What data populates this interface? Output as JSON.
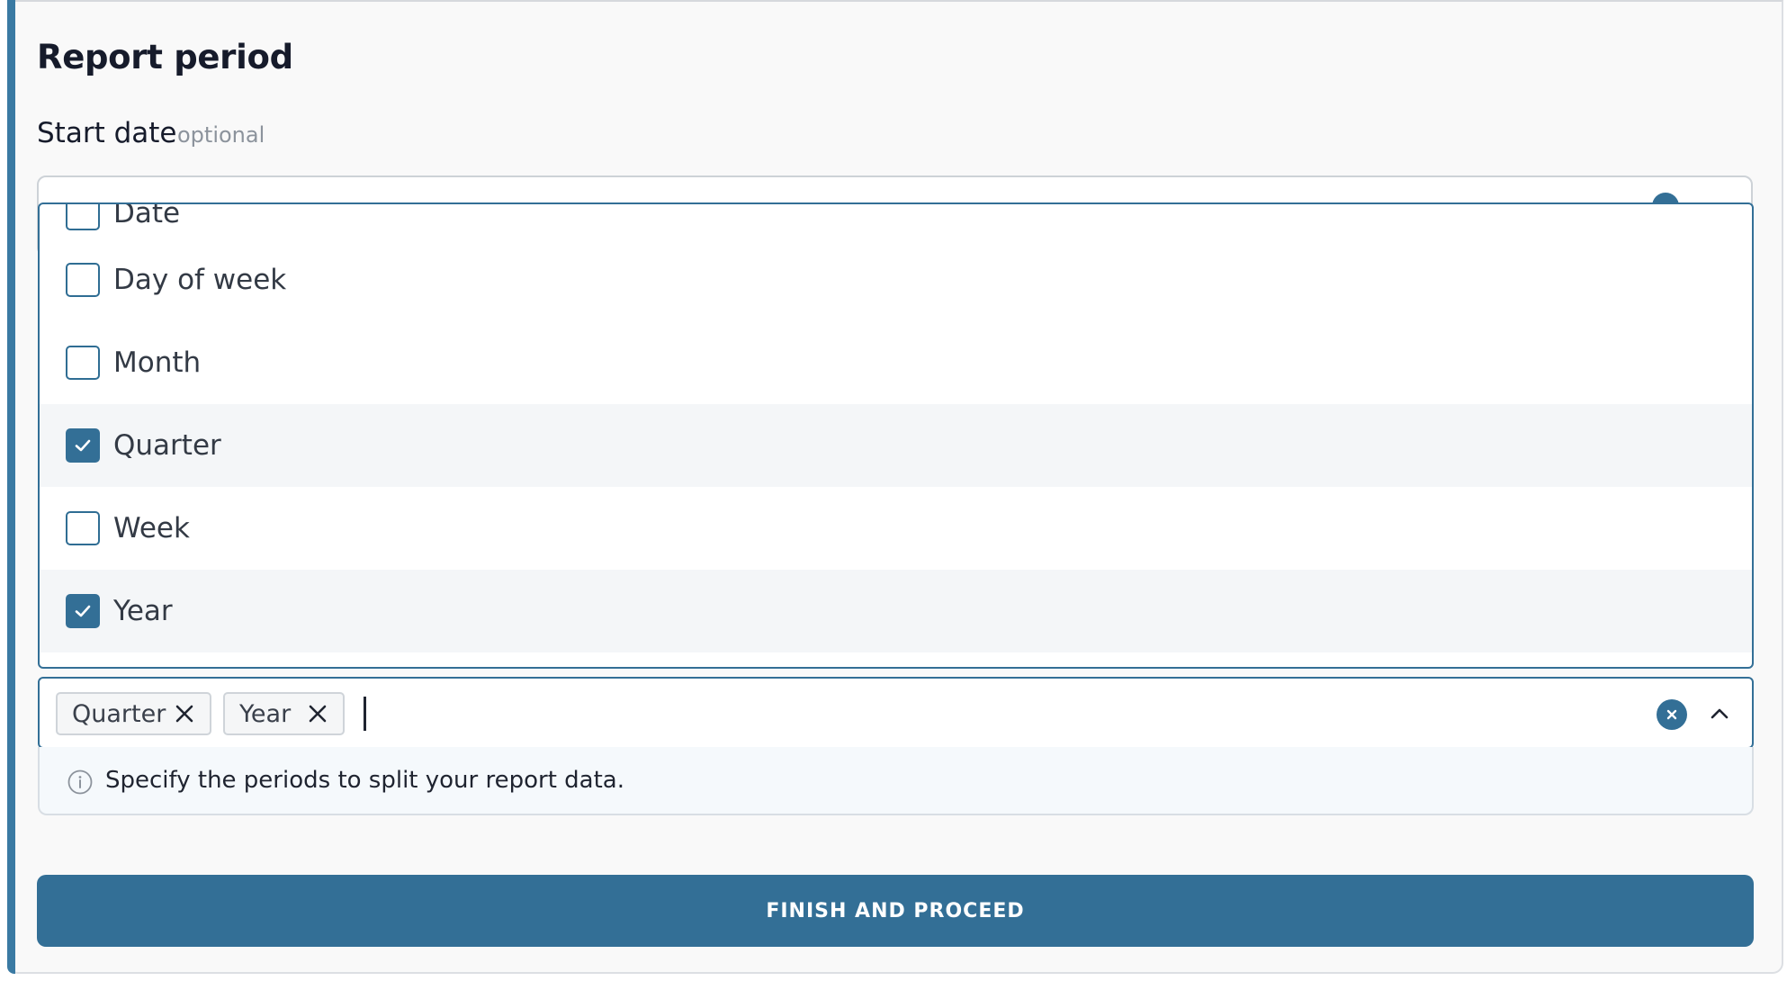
{
  "section": {
    "title": "Report period",
    "field_label": "Start date",
    "field_optional": "optional"
  },
  "dropdown": {
    "options": [
      {
        "label": "Date",
        "checked": false
      },
      {
        "label": "Day of week",
        "checked": false
      },
      {
        "label": "Month",
        "checked": false
      },
      {
        "label": "Quarter",
        "checked": true
      },
      {
        "label": "Week",
        "checked": false
      },
      {
        "label": "Year",
        "checked": true
      }
    ]
  },
  "multiselect": {
    "chips": [
      "Quarter",
      "Year"
    ],
    "value": ""
  },
  "hint": {
    "text": "Specify the periods to split your report data."
  },
  "cta": {
    "label": "FINISH AND PROCEED"
  },
  "colors": {
    "accent": "#336f96",
    "background": "#f9f9f9",
    "selected_row": "#f4f6f8"
  }
}
